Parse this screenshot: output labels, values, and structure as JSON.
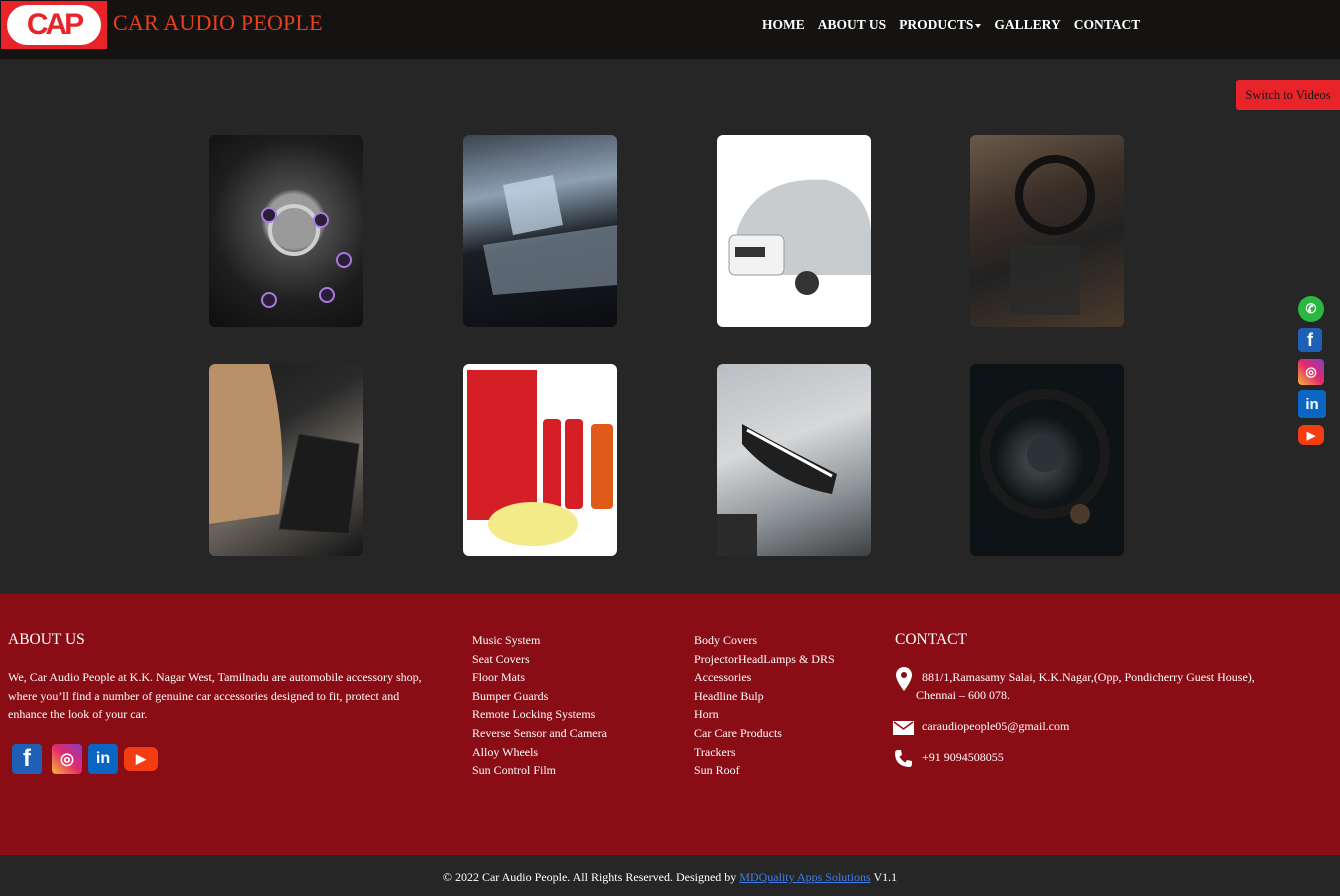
{
  "brand": {
    "logo_text": "CAP",
    "name": "CAR AUDIO PEOPLE"
  },
  "nav": {
    "items": [
      "HOME",
      "ABOUT US",
      "PRODUCTS",
      "GALLERY",
      "CONTACT"
    ]
  },
  "switch_label": "Switch to Videos",
  "gallery": [
    "alloy-wheel-image",
    "sunroof-image",
    "car-body-cover-image",
    "floor-mat-image",
    "seat-cover-floor-mat-image",
    "car-care-kit-image",
    "headlamp-image",
    "steering-wheel-image"
  ],
  "footer": {
    "about_title": "ABOUT US",
    "about_text": "We, Car Audio People at K.K. Nagar West, Tamilnadu are automobile accessory shop, where you’ll find a number of genuine car accessories designed to fit, protect and enhance the look of your car.",
    "col1": [
      "Music System",
      "Seat Covers",
      "Floor Mats",
      "Bumper Guards",
      "Remote Locking Systems",
      "Reverse Sensor and Camera",
      "Alloy Wheels",
      "Sun Control Film"
    ],
    "col2": [
      "Body Covers",
      "ProjectorHeadLamps & DRS",
      "Accessories",
      "Headline Bulp",
      "Horn",
      "Car Care Products",
      "Trackers",
      "Sun Roof"
    ],
    "contact_title": "CONTACT",
    "address_line1": "881/1,Ramasamy Salai, K.K.Nagar,(Opp, Pondicherry Guest House),",
    "address_line2": "Chennai – 600 078.",
    "email": "caraudiopeople05@gmail.com",
    "phone": "+91 9094508055"
  },
  "copyright": {
    "text": "© 2022 Car Audio People. All Rights Reserved. Designed by",
    "link": "MDQuality Apps Solutions",
    "version": "V1.1"
  },
  "colors": {
    "brand_red": "#e8242a",
    "footer_red": "#8a0d16",
    "nav_bg": "#151311"
  }
}
